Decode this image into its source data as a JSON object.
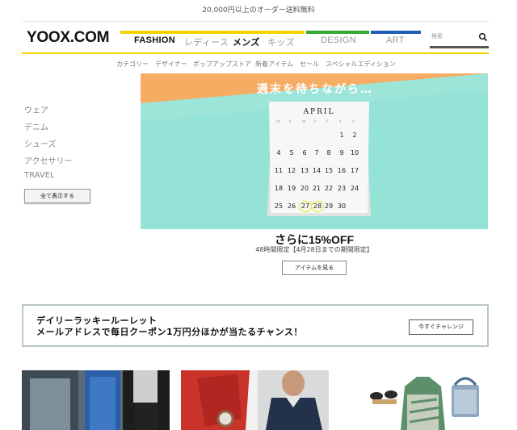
{
  "topbar": {
    "text": "20,000円以上のオーダー送料無料"
  },
  "logo": {
    "text": "YOOX.COM"
  },
  "nav": {
    "fashion": "FASHION",
    "ladies": "レディース",
    "mens": "メンズ",
    "kids": "キッズ",
    "design": "DESIGN",
    "art": "ART",
    "colors": {
      "fashion": "#f2d200",
      "design": "#39a935",
      "art": "#1f5fb5"
    }
  },
  "search": {
    "placeholder": "検索",
    "icon": "search-icon"
  },
  "subnav": {
    "category": "カテゴリー",
    "designer": "デザイナー",
    "popup": "ポップアップストア",
    "new_items": "新着アイテム",
    "sale": "セール",
    "special": "スペシャルエディション"
  },
  "sidebar": {
    "items": [
      "ウェア",
      "デニム",
      "シューズ",
      "アクセサリー",
      "TRAVEL"
    ],
    "show_all": "全て表示する"
  },
  "hero": {
    "title": "週末を待ちながら…",
    "calendar": {
      "month": "APRIL",
      "weekdays": [
        "m",
        "t",
        "w",
        "t",
        "f",
        "s",
        "s"
      ],
      "rows": [
        [
          "",
          "",
          "",
          "",
          "",
          "1",
          "2"
        ],
        [
          "4",
          "5",
          "6",
          "7",
          "8",
          "9",
          "10"
        ],
        [
          "11",
          "12",
          "13",
          "14",
          "15",
          "16",
          "17"
        ],
        [
          "18",
          "19",
          "20",
          "21",
          "22",
          "23",
          "24"
        ],
        [
          "25",
          "26",
          "27",
          "28",
          "29",
          "30",
          ""
        ]
      ],
      "highlighted": [
        "27",
        "28"
      ]
    }
  },
  "promo": {
    "title": "さらに15%OFF",
    "subtitle": "48時間限定【4月28日までの期間限定】",
    "button": "アイテムを見る"
  },
  "roulette": {
    "title": "デイリーラッキールーレット",
    "subtitle": "メールアドレスで毎日クーポン1万円分ほかが当たるチャンス！",
    "button": "今すぐチャレンジ"
  }
}
